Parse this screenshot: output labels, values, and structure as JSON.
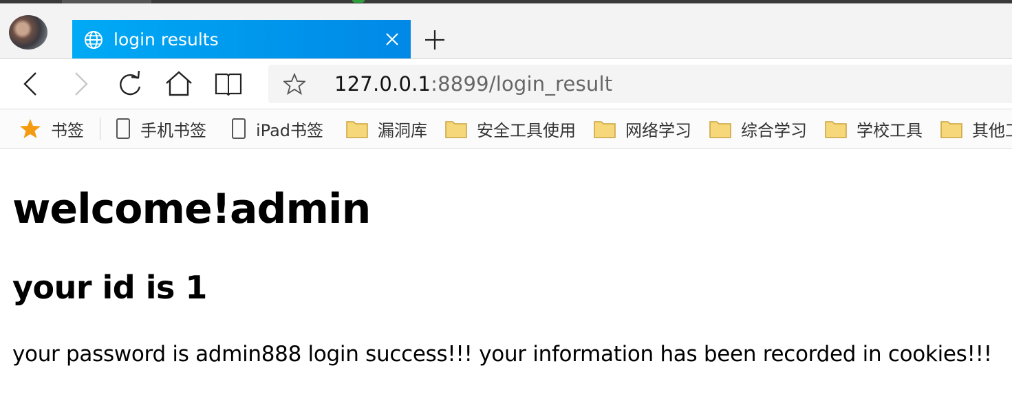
{
  "browser": {
    "tab": {
      "title": "login results",
      "icon": "globe-icon",
      "close_icon": "close-icon"
    },
    "new_tab_icon": "plus-icon",
    "nav": {
      "back_icon": "back-arrow-icon",
      "forward_icon": "forward-arrow-icon",
      "reload_icon": "reload-icon",
      "home_icon": "home-icon",
      "reading_icon": "book-icon"
    },
    "address": {
      "host": "127.0.0.1",
      "rest": ":8899/login_result",
      "favorite_icon": "star-outline-icon"
    },
    "bookmarks": [
      {
        "label": "书签",
        "icon": "star-icon"
      },
      {
        "label": "手机书签",
        "icon": "phone-icon"
      },
      {
        "label": "iPad书签",
        "icon": "tablet-icon"
      },
      {
        "label": "漏洞库",
        "icon": "folder-icon"
      },
      {
        "label": "安全工具使用",
        "icon": "folder-icon"
      },
      {
        "label": "网络学习",
        "icon": "folder-icon"
      },
      {
        "label": "综合学习",
        "icon": "folder-icon"
      },
      {
        "label": "学校工具",
        "icon": "folder-icon"
      },
      {
        "label": "其他工",
        "icon": "folder-icon"
      }
    ],
    "colors": {
      "tab_accent": "#0099ee",
      "bookmark_star": "#f39c12",
      "folder": "#f6d77a"
    }
  },
  "page": {
    "heading": "welcome!admin",
    "subheading": "your id is 1",
    "message": "your password is admin888 login success!!! your information has been recorded in cookies!!!"
  }
}
